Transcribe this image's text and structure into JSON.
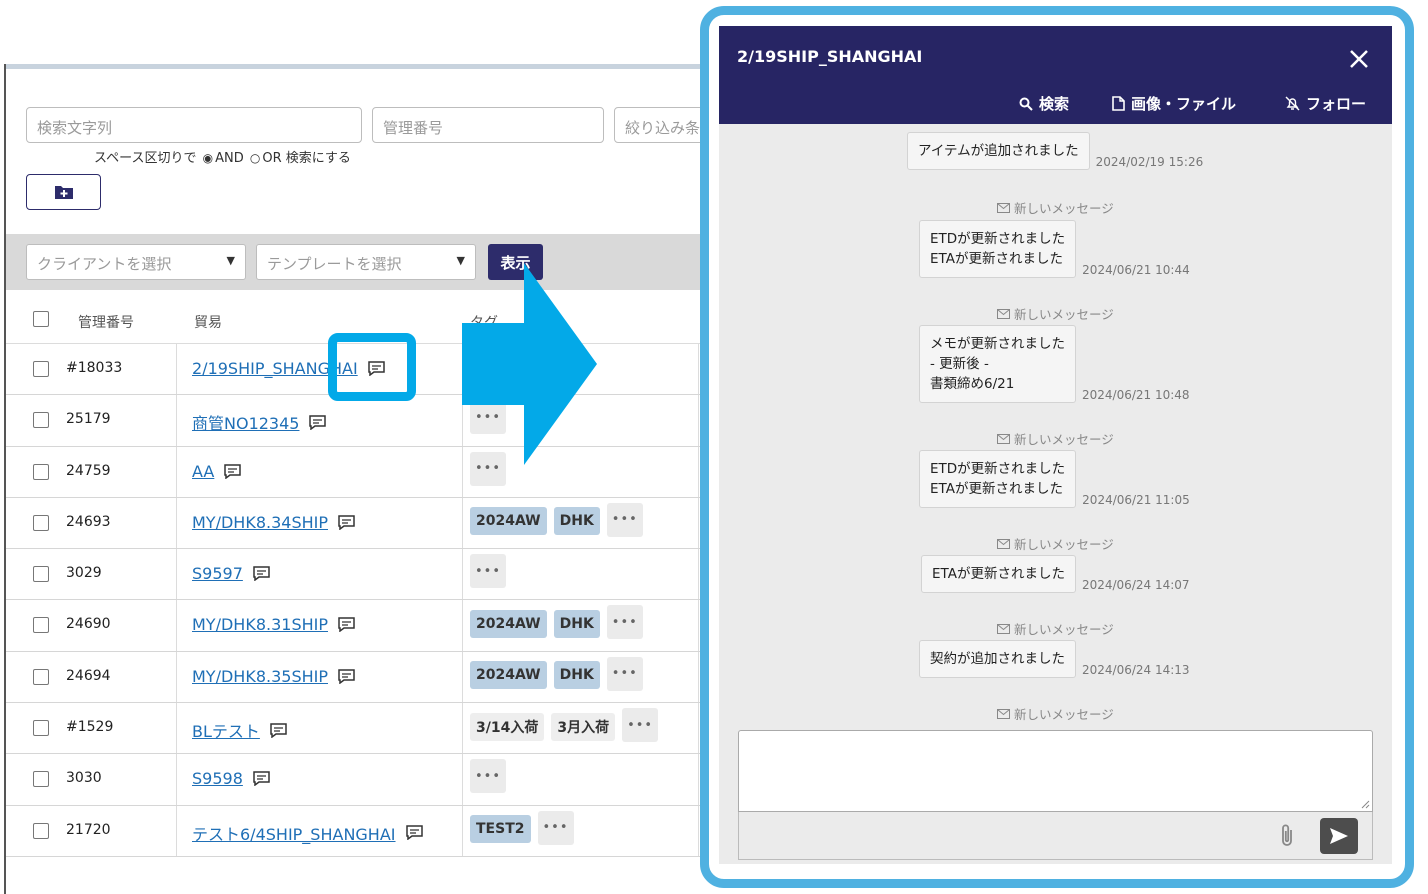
{
  "search": {
    "keyword_placeholder": "検索文字列",
    "number_placeholder": "管理番号",
    "narrow_placeholder": "絞り込み条件",
    "hint_prefix": "スペース区切りで",
    "and_label": "AND",
    "or_label": "OR 検索にする"
  },
  "filter": {
    "client_placeholder": "クライアントを選択",
    "template_placeholder": "テンプレートを選択",
    "show_label": "表示"
  },
  "table": {
    "headers": {
      "number": "管理番号",
      "trade": "貿易",
      "tags": "タグ"
    },
    "rows": [
      {
        "number": "#18033",
        "trade": "2/19SHIP_SHANGHAI",
        "tags": []
      },
      {
        "number": "25179",
        "trade": "商管NO12345",
        "tags": []
      },
      {
        "number": "24759",
        "trade": "AA",
        "tags": []
      },
      {
        "number": "24693",
        "trade": "MY/DHK8.34SHIP",
        "tags": [
          "2024AW",
          "DHK"
        ]
      },
      {
        "number": "3029",
        "trade": "S9597",
        "tags": []
      },
      {
        "number": "24690",
        "trade": "MY/DHK8.31SHIP",
        "tags": [
          "2024AW",
          "DHK"
        ]
      },
      {
        "number": "24694",
        "trade": "MY/DHK8.35SHIP",
        "tags": [
          "2024AW",
          "DHK"
        ]
      },
      {
        "number": "#1529",
        "trade": "BLテスト",
        "tags": [
          "3/14入荷",
          "3月入荷"
        ]
      },
      {
        "number": "3030",
        "trade": "S9598",
        "tags": []
      },
      {
        "number": "21720",
        "trade": "テスト6/4SHIP_SHANGHAI",
        "tags": [
          "TEST2"
        ]
      }
    ],
    "more_label": "•••"
  },
  "chat": {
    "title": "2/19SHIP_SHANGHAI",
    "search_label": "検索",
    "files_label": "画像・ファイル",
    "follow_label": "フォロー",
    "new_message_label": "新しいメッセージ",
    "messages": [
      {
        "lines": [
          "アイテムが追加されました"
        ],
        "time": "2024/02/19 15:26"
      },
      {
        "lines": [
          "ETDが更新されました",
          "ETAが更新されました"
        ],
        "time": "2024/06/21 10:44"
      },
      {
        "lines": [
          "メモが更新されました",
          "- 更新後 -",
          "書類締め6/21"
        ],
        "time": "2024/06/21 10:48"
      },
      {
        "lines": [
          "ETDが更新されました",
          "ETAが更新されました"
        ],
        "time": "2024/06/21 11:05"
      },
      {
        "lines": [
          "ETAが更新されました"
        ],
        "time": "2024/06/24 14:07"
      },
      {
        "lines": [
          "契約が追加されました"
        ],
        "time": "2024/06/24 14:13"
      }
    ],
    "compose_value": ""
  },
  "colors": {
    "navy": "#272564",
    "highlight": "#03a9e8",
    "frame": "#4fb1e1",
    "link": "#1f6fb6",
    "tag": "#b9cfe2"
  }
}
